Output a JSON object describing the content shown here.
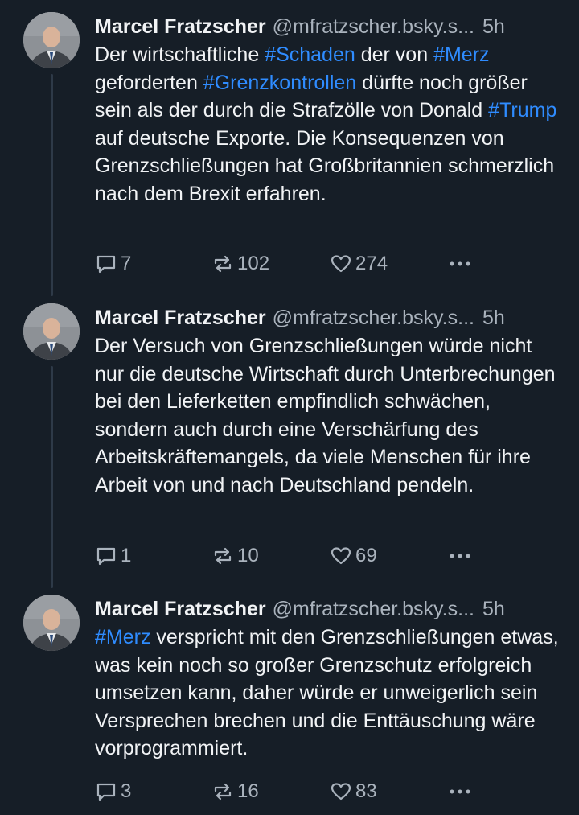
{
  "posts": [
    {
      "author": "Marcel Fratzscher",
      "handle": "@mfratzscher.bsky.s...",
      "time": "5h",
      "segments": [
        {
          "text": "Der wirtschaftliche "
        },
        {
          "text": "#Schaden",
          "tag": true
        },
        {
          "text": " der von "
        },
        {
          "text": "#Merz",
          "tag": true
        },
        {
          "text": " geforderten "
        },
        {
          "text": "#Grenzkontrollen",
          "tag": true
        },
        {
          "text": " dürfte noch größer sein als der durch die Strafzölle von Donald "
        },
        {
          "text": "#Trump",
          "tag": true
        },
        {
          "text": " auf deutsche Exporte. Die Konsequenzen von Grenzschließungen hat Großbritannien schmerzlich nach dem Brexit erfahren."
        }
      ],
      "replies": "7",
      "reposts": "102",
      "likes": "274"
    },
    {
      "author": "Marcel Fratzscher",
      "handle": "@mfratzscher.bsky.s...",
      "time": "5h",
      "segments": [
        {
          "text": "Der Versuch von Grenzschließungen würde nicht nur die deutsche Wirtschaft durch Unterbrechungen bei den Lieferketten empfindlich schwächen, sondern auch durch eine Verschärfung des Arbeitskräftemangels, da viele Menschen für ihre Arbeit von und nach Deutschland pendeln."
        }
      ],
      "replies": "1",
      "reposts": "10",
      "likes": "69"
    },
    {
      "author": "Marcel Fratzscher",
      "handle": "@mfratzscher.bsky.s...",
      "time": "5h",
      "segments": [
        {
          "text": "#Merz",
          "tag": true
        },
        {
          "text": " verspricht mit den Grenzschließungen etwas, was kein noch so großer Grenzschutz erfolgreich umsetzen kann, daher würde er unweigerlich sein Versprechen brechen und die Enttäuschung wäre vorprogrammiert."
        }
      ],
      "replies": "3",
      "reposts": "16",
      "likes": "83"
    }
  ],
  "icons": {
    "reply": "speech-bubble-icon",
    "repost": "repost-arrows-icon",
    "like": "heart-icon",
    "more": "ellipsis-icon"
  },
  "colors": {
    "background": "#161e27",
    "text": "#f1f3f5",
    "muted": "#aab3bd",
    "hashtag": "#2f8cff",
    "thread_line": "#2e3a48"
  }
}
